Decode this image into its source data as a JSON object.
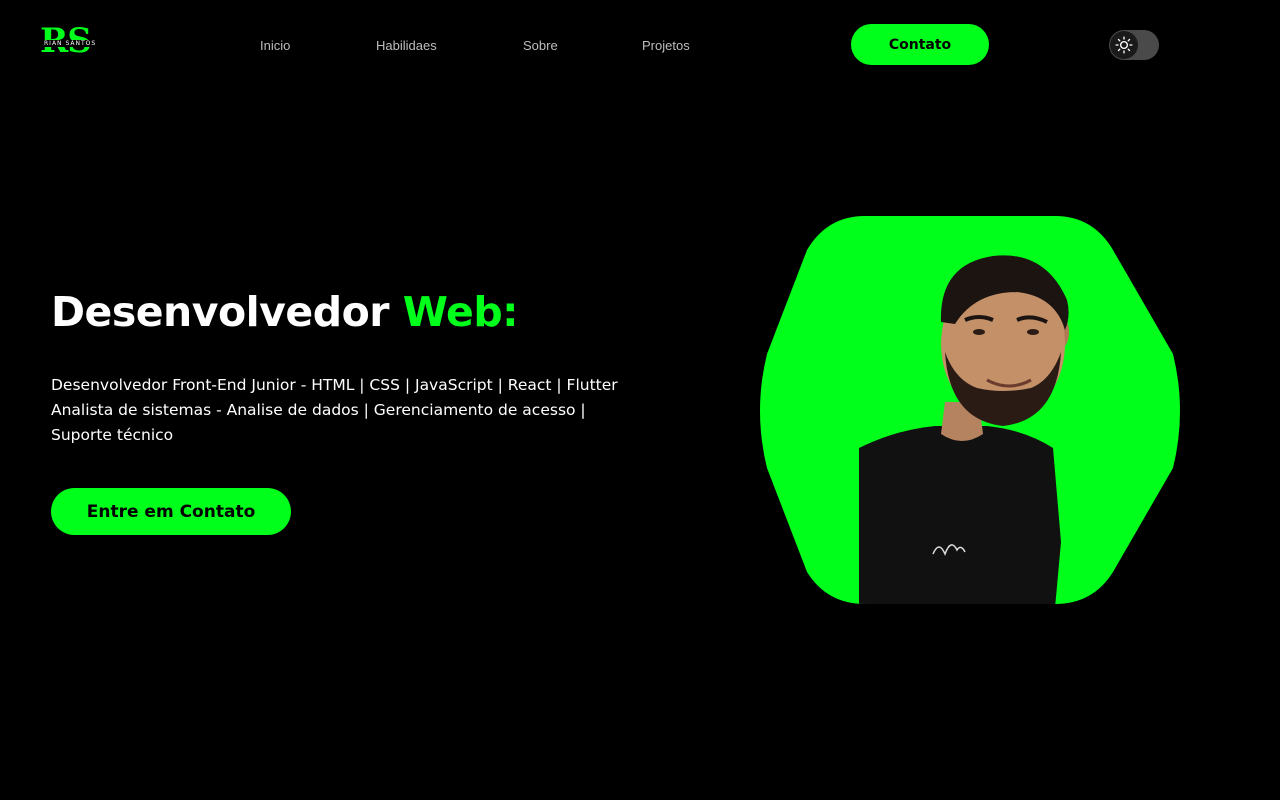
{
  "logo": {
    "letters": "RS",
    "subtitle": "RIAN SANTOS"
  },
  "nav": {
    "items": [
      {
        "label": "Inicio"
      },
      {
        "label": "Habilidaes"
      },
      {
        "label": "Sobre"
      },
      {
        "label": "Projetos"
      }
    ]
  },
  "header": {
    "contact_button": "Contato",
    "theme_toggle_icon": "sun-icon"
  },
  "hero": {
    "title_main": "Desenvolvedor",
    "title_accent": "Web:",
    "description_line1": "Desenvolvedor Front-End Junior - HTML | CSS | JavaScript | React | Flutter",
    "description_line2": "Analista de sistemas - Analise de dados | Gerenciamento de acesso |",
    "description_line3": "Suporte técnico",
    "cta_button": "Entre em Contato",
    "portrait_icon": "profile-portrait"
  },
  "colors": {
    "accent": "#00ff1a",
    "background": "#000000",
    "text": "#ffffff",
    "nav_text": "#bdbdbd"
  }
}
